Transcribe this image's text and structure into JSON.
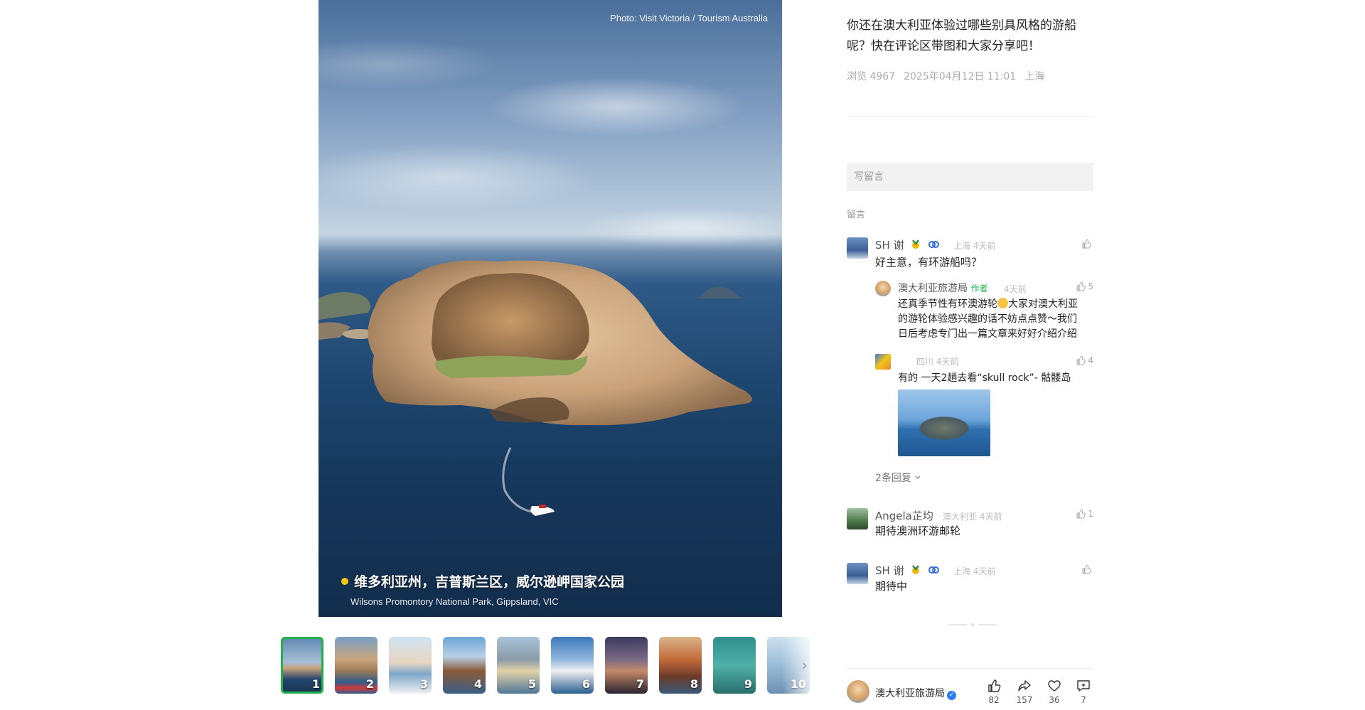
{
  "photo": {
    "credit": "Photo: Visit Victoria / Tourism Australia",
    "caption_title": "维多利亚州，吉普斯兰区，威尔逊岬国家公园",
    "caption_subtitle": "Wilsons Promontory National Park, Gippsland, VIC"
  },
  "thumbnails": [
    "1",
    "2",
    "3",
    "4",
    "5",
    "6",
    "7",
    "8",
    "9",
    "10"
  ],
  "post": {
    "description": "你还在澳大利亚体验过哪些别具风格的游船呢？快在评论区带图和大家分享吧！",
    "views": "浏览 4967",
    "date": "2025年04月12日 11:01",
    "location": "上海"
  },
  "comment_box": {
    "placeholder": "写留言"
  },
  "comments_label": "留言",
  "comments": [
    {
      "name": "SH 谢",
      "meta": "上海 4天前",
      "text": "好主意，有环游船吗？",
      "likes": "",
      "replies": [
        {
          "name": "澳大利亚旅游局",
          "tag": "作者",
          "meta": "4天前",
          "likes": "5",
          "text_lines": [
            "还真季节性有环澳游轮",
            "大家对澳大利亚",
            "的游轮体验感兴趣的话不妨点点赞～我们",
            "日后考虑专门出一篇文章来好好介绍介绍"
          ]
        },
        {
          "name": "",
          "meta": "四川 4天前",
          "likes": "4",
          "text": "有的 一天2趟去看“skull rock”- 骷髅岛"
        }
      ],
      "more_replies": "2条回复"
    },
    {
      "name": "Angela芷均",
      "meta": "澳大利亚 4天前",
      "text": "期待澳洲环游邮轮",
      "likes": "1"
    },
    {
      "name": "SH 谢",
      "meta": "上海 4天前",
      "text": "期待中",
      "likes": ""
    }
  ],
  "bottom_bar": {
    "author": "澳大利亚旅游局",
    "likes": "82",
    "shares": "157",
    "favorites": "36",
    "comments": "7"
  }
}
